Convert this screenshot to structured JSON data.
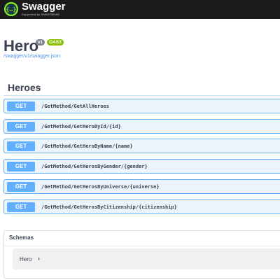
{
  "topbar": {
    "brand": "Swagger",
    "brand_sub": "Supported by SMARTBEAR",
    "logo_icon": "swagger-logo-icon",
    "logo_color": "#85ea2d"
  },
  "info": {
    "title": "Hero",
    "version": "v1",
    "oas": "OAS3",
    "spec_link": "/swagger/v1/swagger.json"
  },
  "tag": {
    "name": "Heroes"
  },
  "operations": [
    {
      "method": "GET",
      "path": "/GetMethod/GetAllHeroes"
    },
    {
      "method": "GET",
      "path": "/GetMethod/GetHeroById/{id}"
    },
    {
      "method": "GET",
      "path": "/GetMethod/GetHeroByName/{name}"
    },
    {
      "method": "GET",
      "path": "/GetMethod/GetHerosByGender/{gender}"
    },
    {
      "method": "GET",
      "path": "/GetMethod/GetHerosByUniverse/{universe}"
    },
    {
      "method": "GET",
      "path": "/GetMethod/GetHerosByCitizenship/{citizenship}"
    }
  ],
  "schemas": {
    "title": "Schemas",
    "models": [
      {
        "name": "Hero",
        "arrow": "›"
      }
    ]
  },
  "colors": {
    "get_accent": "#61affe",
    "get_background": "#ebf3fb",
    "topbar": "#1b1b1b",
    "link": "#4990e2",
    "version_badge": "#7d8492",
    "oas_badge": "#89bf04"
  }
}
